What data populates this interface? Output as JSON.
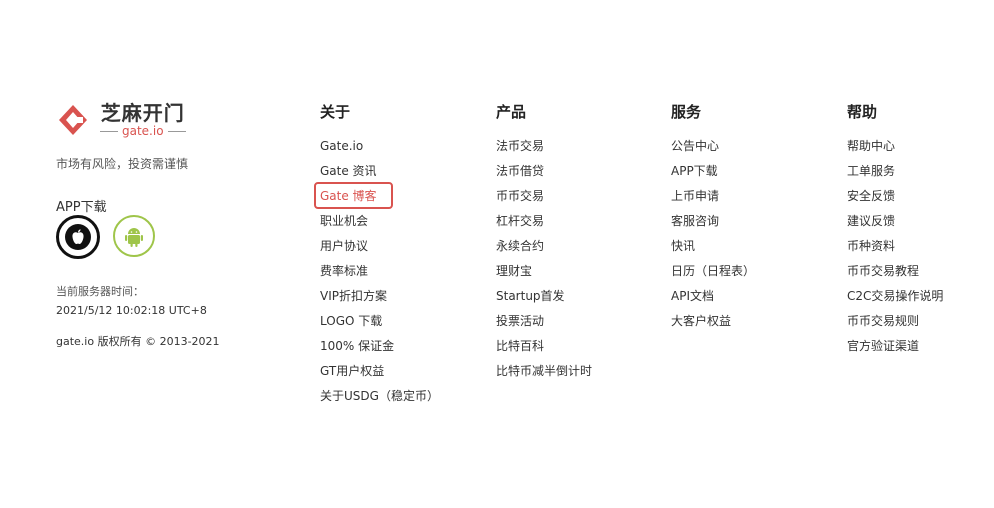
{
  "brand": {
    "logo_cn": "芝麻开门",
    "logo_sub": "gate.io",
    "risk_text": "市场有风险，投资需谨慎",
    "app_title": "APP下载",
    "server_label": "当前服务器时间：",
    "server_time": "2021/5/12 10:02:18 UTC+8",
    "copyright": "gate.io 版权所有 © 2013-2021",
    "accent_color": "#d9534f"
  },
  "columns": [
    {
      "title": "关于",
      "items": [
        "Gate.io",
        "Gate 资讯",
        "Gate 博客",
        "职业机会",
        "用户协议",
        "费率标准",
        "VIP折扣方案",
        "LOGO 下载",
        "100% 保证金",
        "GT用户权益",
        "关于USDG（稳定币）"
      ]
    },
    {
      "title": "产品",
      "items": [
        "法币交易",
        "法币借贷",
        "币币交易",
        "杠杆交易",
        "永续合约",
        "理财宝",
        "Startup首发",
        "投票活动",
        "比特百科",
        "比特币减半倒计时"
      ]
    },
    {
      "title": "服务",
      "items": [
        "公告中心",
        "APP下载",
        "上币申请",
        "客服咨询",
        "快讯",
        "日历（日程表）",
        "API文档",
        "大客户权益"
      ]
    },
    {
      "title": "帮助",
      "items": [
        "帮助中心",
        "工单服务",
        "安全反馈",
        "建议反馈",
        "币种资料",
        "币币交易教程",
        "C2C交易操作说明",
        "币币交易规则",
        "官方验证渠道"
      ]
    }
  ]
}
